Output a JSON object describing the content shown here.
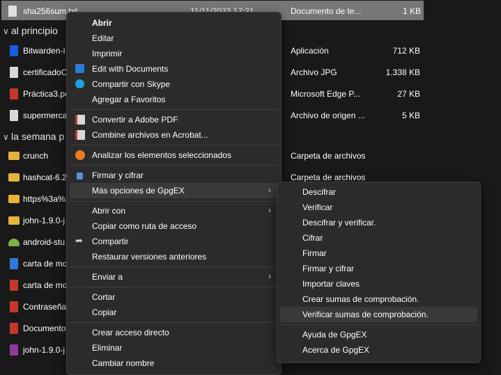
{
  "files_top": {
    "name": "sha256sum.txt",
    "date": "11/11/2022 17:21",
    "type": "Documento de te...",
    "size": "1 KB"
  },
  "groups": {
    "principio": "al principio",
    "semana": "la semana p"
  },
  "files_a": [
    {
      "name": "Bitwarden-I",
      "type": "Aplicación",
      "size": "712 KB",
      "icon": "bitwarden-icon"
    },
    {
      "name": "certificadoC",
      "type": "Archivo JPG",
      "size": "1.338 KB",
      "icon": "image-file-icon"
    },
    {
      "name": "Práctica3.pc",
      "type": "Microsoft Edge P...",
      "size": "27 KB",
      "icon": "pdf-icon"
    },
    {
      "name": "supermerca",
      "type": "Archivo de origen ...",
      "size": "5 KB",
      "icon": "source-file-icon"
    }
  ],
  "files_b": [
    {
      "name": "crunch",
      "type": "Carpeta de archivos",
      "icon": "folder-icon"
    },
    {
      "name": "hashcat-6.2",
      "type": "Carpeta de archivos",
      "icon": "folder-icon"
    },
    {
      "name": "https%3a%2",
      "type": "",
      "icon": "folder-icon"
    },
    {
      "name": "john-1.9.0-j",
      "type": "",
      "icon": "folder-icon"
    },
    {
      "name": "android-stu",
      "type": "",
      "icon": "android-icon"
    },
    {
      "name": "carta de mo",
      "type": "",
      "icon": "document-icon"
    },
    {
      "name": "carta de mo",
      "type": "",
      "icon": "pdf-icon"
    },
    {
      "name": "Contraseñas",
      "type": "",
      "icon": "pdf-icon"
    },
    {
      "name": "Documento",
      "type": "",
      "icon": "pdf-icon"
    },
    {
      "name": "john-1.9.0-j",
      "type": "",
      "icon": "archive-icon"
    }
  ],
  "context_menu": {
    "open": "Abrir",
    "edit": "Editar",
    "print": "Imprimir",
    "edit_documents": "Edit with Documents",
    "share_skype": "Compartir con Skype",
    "add_favorites": "Agregar a Favoritos",
    "convert_pdf": "Convertir a Adobe PDF",
    "combine_acrobat": "Combine archivos en Acrobat...",
    "analyze": "Analizar los elementos seleccionados",
    "sign_encrypt": "Firmar y cifrar",
    "more_gpgex": "Más opciones de GpgEX",
    "open_with": "Abrir con",
    "copy_path": "Copiar como ruta de acceso",
    "share": "Compartir",
    "restore": "Restaurar versiones anteriores",
    "send_to": "Enviar a",
    "cut": "Cortar",
    "copy": "Copiar",
    "create_shortcut": "Crear acceso directo",
    "delete": "Eliminar",
    "rename": "Cambiar nombre"
  },
  "submenu": {
    "decrypt": "Descifrar",
    "verify": "Verificar",
    "decrypt_verify": "Descifrar y verificar.",
    "encrypt": "Cifrar",
    "sign": "Firmar",
    "sign_encrypt": "Firmar y cifrar",
    "import_keys": "Importar claves",
    "create_checksums": "Crear sumas de comprobación.",
    "verify_checksums": "Verificar sumas de comprobación.",
    "help": "Ayuda de GpgEX",
    "about": "Acerca de GpgEX"
  }
}
